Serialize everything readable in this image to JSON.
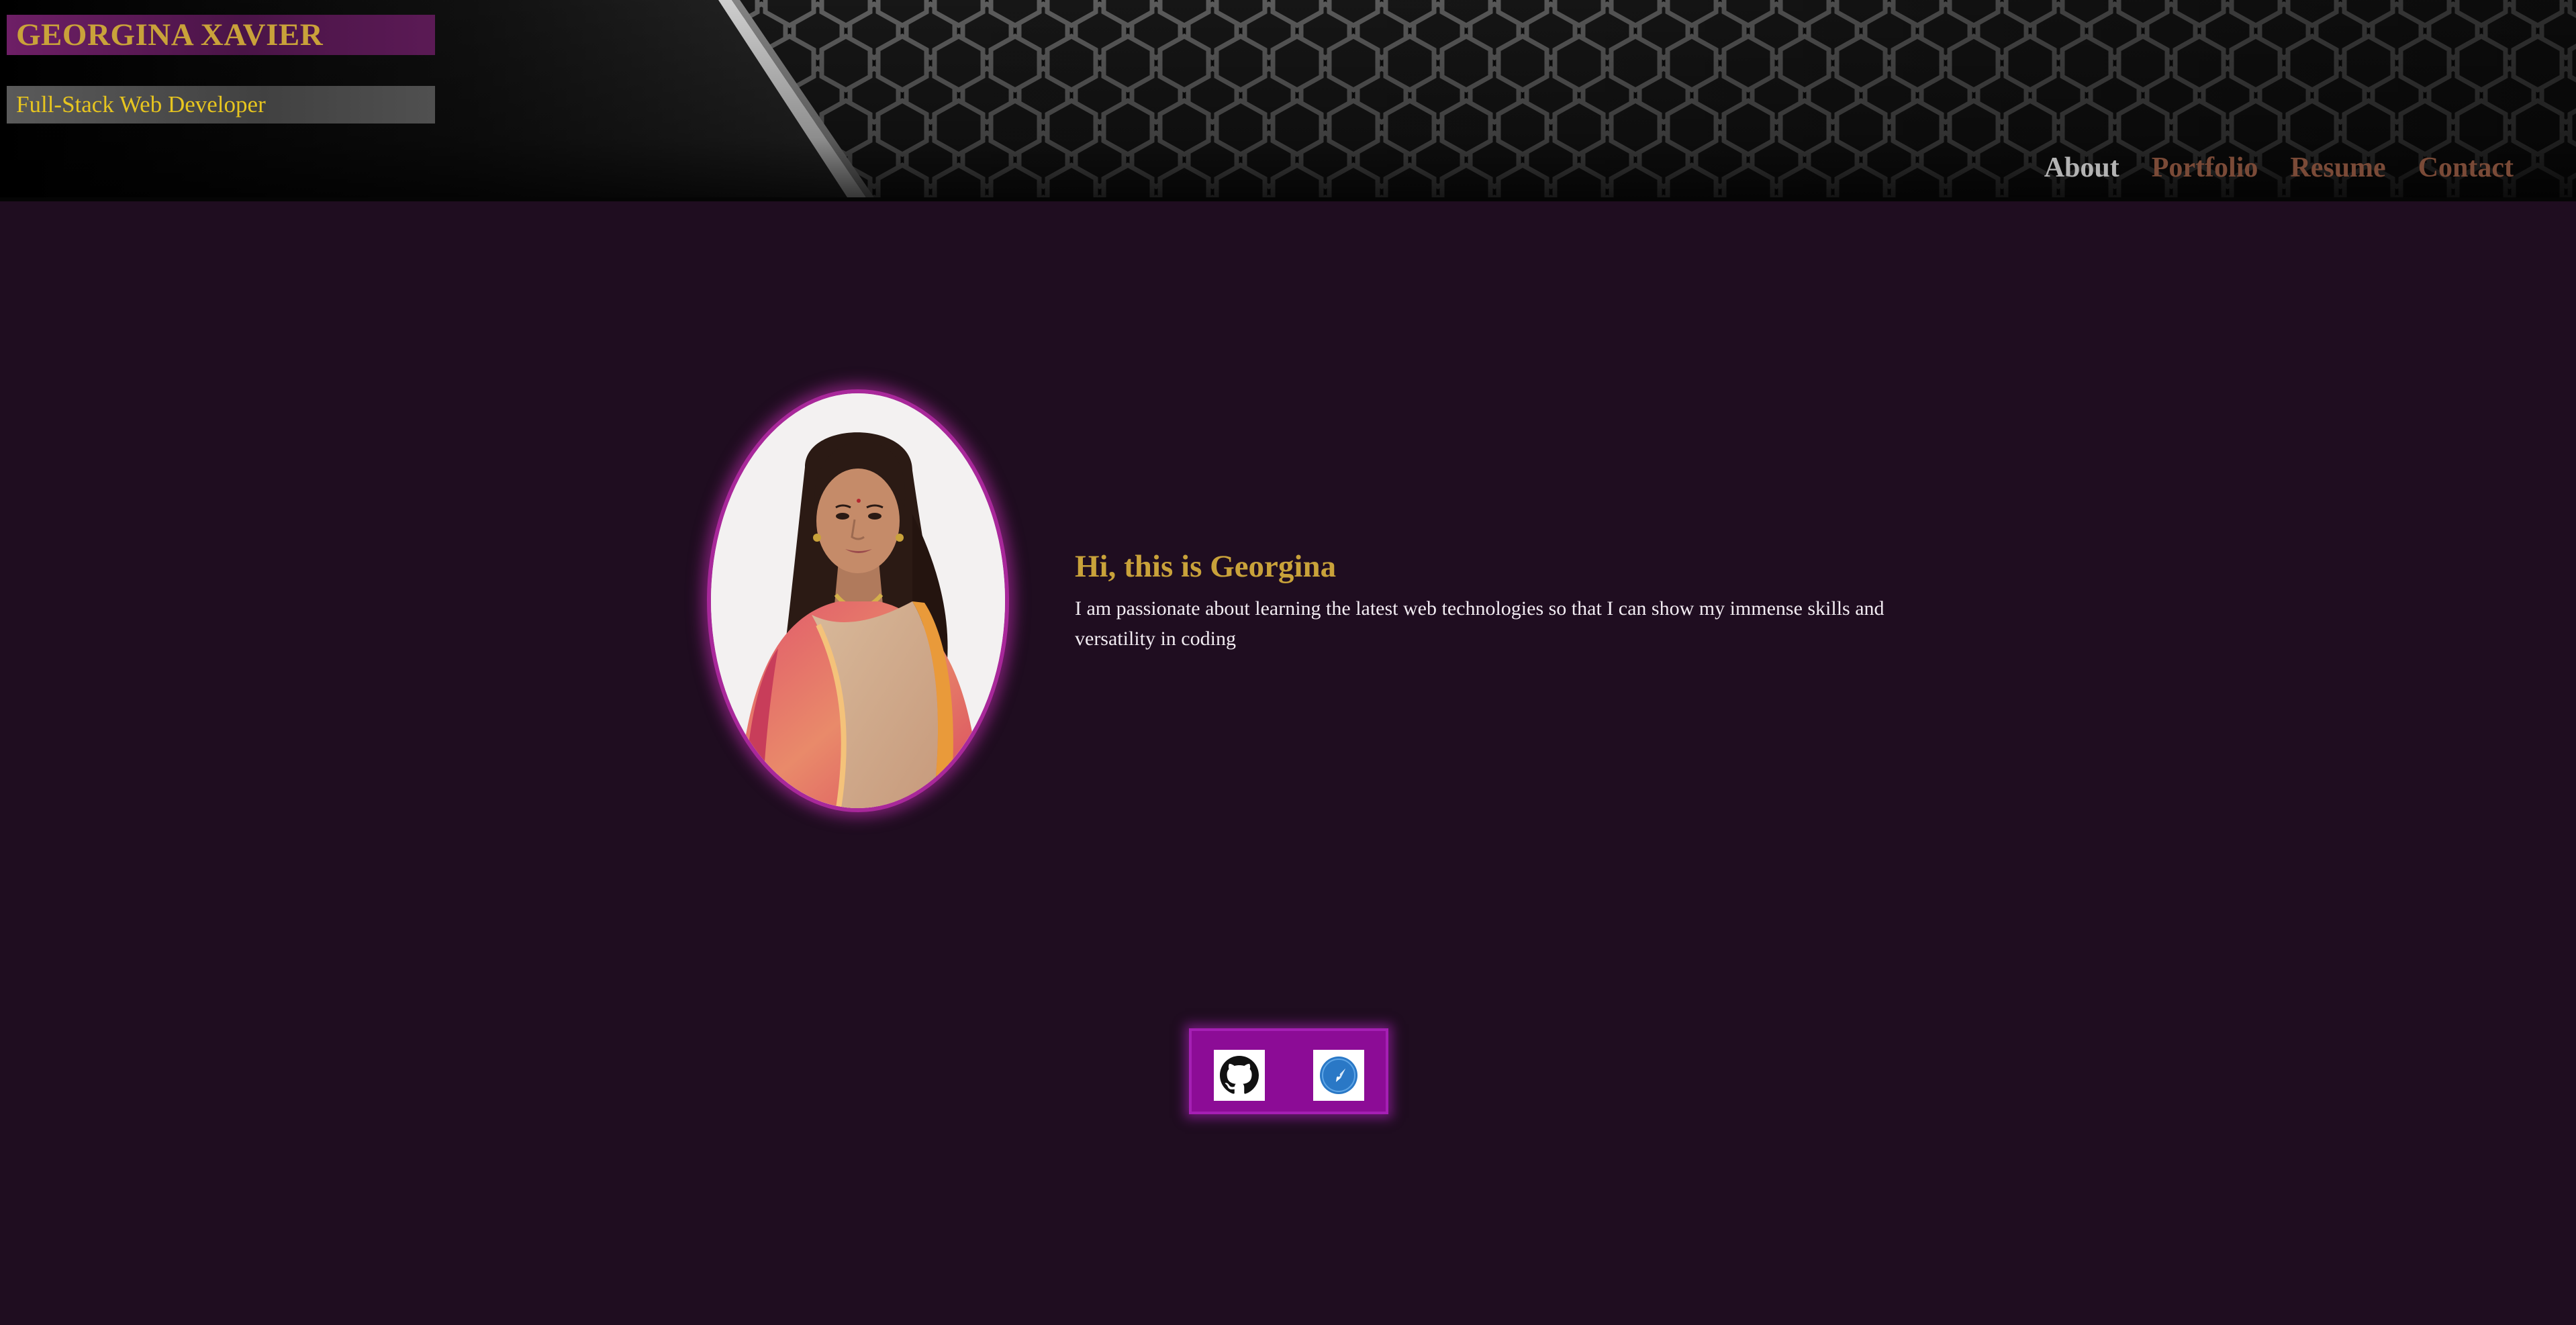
{
  "header": {
    "name": "GEORGINA XAVIER",
    "tagline": "Full-Stack Web Developer"
  },
  "nav": {
    "items": [
      {
        "label": "About",
        "active": true
      },
      {
        "label": "Portfolio",
        "active": false
      },
      {
        "label": "Resume",
        "active": false
      },
      {
        "label": "Contact",
        "active": false
      }
    ]
  },
  "about": {
    "title": "Hi, this is Georgina",
    "body": "I am passionate about learning the latest web technologies so that I can show my immense skills and versatility in coding"
  },
  "social": {
    "items": [
      {
        "icon": "github-icon"
      },
      {
        "icon": "compass-icon"
      }
    ]
  },
  "colors": {
    "page_background": "#1f0d20",
    "accent_gold": "#c9a23a",
    "nav_inactive": "#7a4a37",
    "nav_active": "#b3b3b3",
    "social_panel": "#8c0c96",
    "portrait_ring": "#a8289a"
  }
}
